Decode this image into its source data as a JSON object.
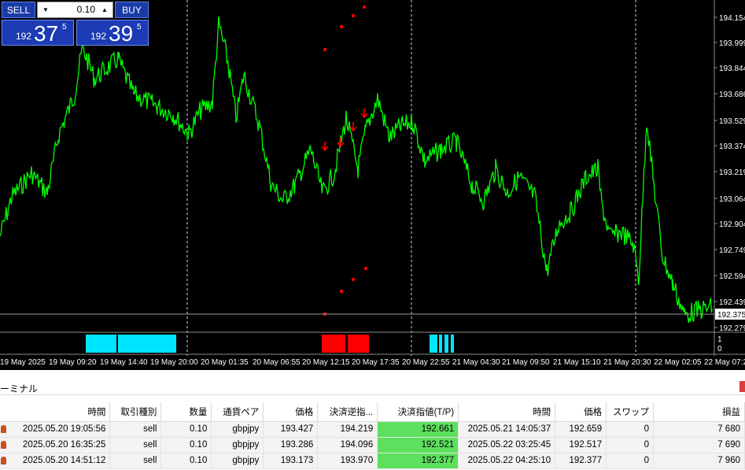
{
  "trade_panel": {
    "sell_label": "SELL",
    "buy_label": "BUY",
    "lot": "0.10",
    "sell_prefix": "192",
    "sell_big": "37",
    "sell_sup": "5",
    "buy_prefix": "192",
    "buy_big": "39",
    "buy_sup": "5"
  },
  "price_axis": {
    "labels": [
      "194.154",
      "193.999",
      "193.844",
      "193.686",
      "193.529",
      "193.374",
      "193.219",
      "193.064",
      "192.904",
      "192.749",
      "192.594",
      "192.439",
      "192.375",
      "192.279"
    ],
    "current_price": "192.375"
  },
  "indicator_axis": {
    "labels": [
      "1",
      "0"
    ]
  },
  "time_axis": {
    "labels": [
      "19 May 2025",
      "19 May 09:20",
      "19 May 14:40",
      "19 May 20:00",
      "20 May 01:35",
      "20 May 06:55",
      "20 May 12:15",
      "20 May 17:35",
      "20 May 22:55",
      "21 May 04:30",
      "21 May 09:50",
      "21 May 15:10",
      "21 May 20:30",
      "22 May 02:05",
      "22 May 07:2"
    ]
  },
  "colors": {
    "background": "#000000",
    "price_line": "#00ff00",
    "indicator_buy": "#00e5ff",
    "indicator_sell": "#ff0000",
    "tp_cell": "#5ee05e"
  },
  "terminal": {
    "title": "ーミナル",
    "columns": [
      "時間",
      "取引種別",
      "数量",
      "通貨ペア",
      "価格",
      "決済逆指...",
      "決済指値(T/P)",
      "時間",
      "価格",
      "スワップ",
      "損益"
    ],
    "rows": [
      [
        "2025.05.20 19:05:56",
        "sell",
        "0.10",
        "gbpjpy",
        "193.427",
        "194.219",
        "192.661",
        "2025.05.21 14:05:37",
        "192.659",
        "0",
        "7 680"
      ],
      [
        "2025.05.20 16:35:25",
        "sell",
        "0.10",
        "gbpjpy",
        "193.286",
        "194.096",
        "192.521",
        "2025.05.22 03:25:45",
        "192.517",
        "0",
        "7 690"
      ],
      [
        "2025.05.20 14:51:12",
        "sell",
        "0.10",
        "gbpjpy",
        "193.173",
        "193.970",
        "192.377",
        "2025.05.22 04:25:10",
        "192.377",
        "0",
        "7 960"
      ]
    ]
  }
}
